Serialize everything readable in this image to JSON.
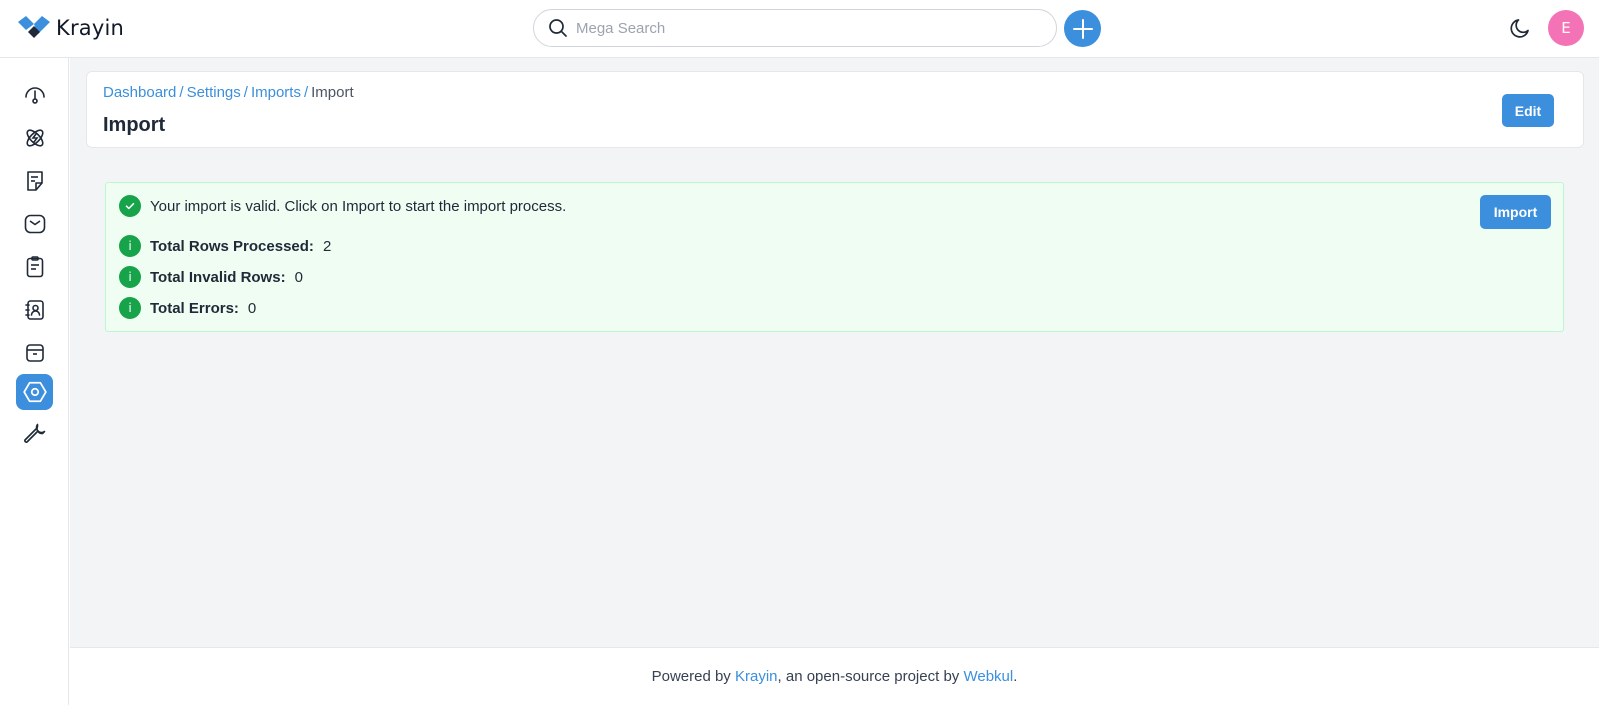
{
  "header": {
    "logo_text": "Krayin",
    "search_placeholder": "Mega Search",
    "avatar_letter": "E"
  },
  "sidebar": {
    "items": [
      {
        "name": "dashboard",
        "icon": "gauge-icon"
      },
      {
        "name": "leads",
        "icon": "atom-icon"
      },
      {
        "name": "quotes",
        "icon": "note-icon"
      },
      {
        "name": "mail",
        "icon": "mail-icon"
      },
      {
        "name": "activities",
        "icon": "clipboard-icon"
      },
      {
        "name": "contacts",
        "icon": "contact-book-icon"
      },
      {
        "name": "products",
        "icon": "box-icon"
      },
      {
        "name": "settings",
        "icon": "settings-hex-icon",
        "active": true
      },
      {
        "name": "configuration",
        "icon": "wrench-icon"
      }
    ]
  },
  "breadcrumb": {
    "items": [
      "Dashboard",
      "Settings",
      "Imports"
    ],
    "current": "Import",
    "separator": "/"
  },
  "page": {
    "title": "Import",
    "edit_label": "Edit"
  },
  "import_result": {
    "message": "Your import is valid. Click on Import to start the import process.",
    "import_label": "Import",
    "stats": [
      {
        "label": "Total Rows Processed:",
        "value": "2"
      },
      {
        "label": "Total Invalid Rows:",
        "value": "0"
      },
      {
        "label": "Total Errors:",
        "value": "0"
      }
    ]
  },
  "footer": {
    "prefix": "Powered by ",
    "link1": "Krayin",
    "middle": ", an open-source project by ",
    "link2": "Webkul",
    "suffix": "."
  },
  "colors": {
    "accent": "#3b8fdc",
    "success": "#16a34a",
    "success_bg": "#effdf3",
    "avatar": "#f472b6"
  }
}
